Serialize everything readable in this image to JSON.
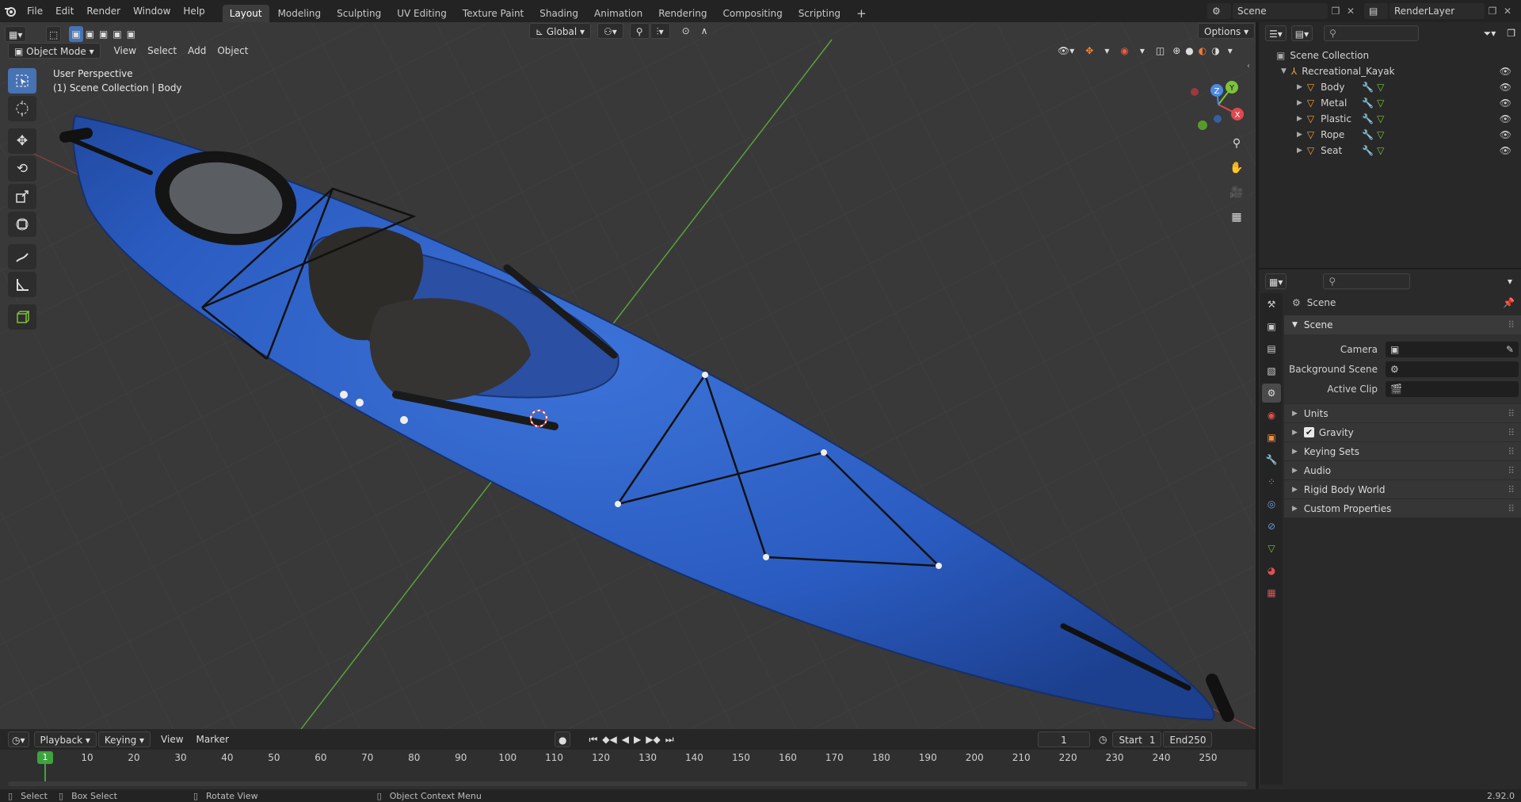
{
  "topbar": {
    "menus": [
      "File",
      "Edit",
      "Render",
      "Window",
      "Help"
    ],
    "workspaces": [
      "Layout",
      "Modeling",
      "Sculpting",
      "UV Editing",
      "Texture Paint",
      "Shading",
      "Animation",
      "Rendering",
      "Compositing",
      "Scripting"
    ],
    "active_workspace": "Layout",
    "scene_name": "Scene",
    "view_layer": "RenderLayer"
  },
  "viewport": {
    "mode": "Object Mode",
    "menus": [
      "View",
      "Select",
      "Add",
      "Object"
    ],
    "transform_orientation": "Global",
    "options_label": "Options",
    "overlay_title": "User Perspective",
    "overlay_subtitle": "(1) Scene Collection | Body",
    "gizmo_axes": [
      "X",
      "Y",
      "Z"
    ]
  },
  "toolbar_icons": [
    "select-box-icon",
    "cursor-icon",
    "move-icon",
    "rotate-icon",
    "scale-icon",
    "transform-icon",
    "annotate-icon",
    "measure-icon",
    "add-cube-icon"
  ],
  "outliner": {
    "root": "Scene Collection",
    "collection": "Recreational_Kayak",
    "objects": [
      "Body",
      "Metal",
      "Plastic",
      "Rope",
      "Seat"
    ]
  },
  "properties": {
    "context_title": "Scene",
    "section": "Scene",
    "fields": [
      {
        "label": "Camera",
        "value": ""
      },
      {
        "label": "Background Scene",
        "value": ""
      },
      {
        "label": "Active Clip",
        "value": ""
      }
    ],
    "subpanels": [
      "Units",
      "Gravity",
      "Keying Sets",
      "Audio",
      "Rigid Body World",
      "Custom Properties"
    ],
    "gravity_checked": true
  },
  "timeline": {
    "menus": [
      "Playback",
      "Keying",
      "View",
      "Marker"
    ],
    "current_frame": "1",
    "start_label": "Start",
    "start_value": "1",
    "end_label": "End",
    "end_value": "250",
    "ticks": [
      "10",
      "20",
      "30",
      "40",
      "50",
      "60",
      "70",
      "80",
      "90",
      "100",
      "110",
      "120",
      "130",
      "140",
      "150",
      "160",
      "170",
      "180",
      "190",
      "200",
      "210",
      "220",
      "230",
      "240",
      "250"
    ],
    "playhead_label": "1"
  },
  "statusbar": {
    "items": [
      "Select",
      "Box Select",
      "Rotate View",
      "Object Context Menu"
    ],
    "version": "2.92.0"
  },
  "colors": {
    "accent": "#4772b3",
    "kayak_blue": "#2d5fc4",
    "active_frame": "#3ea33e",
    "x_axis": "#e0484f",
    "y_axis": "#7ec23a",
    "z_axis": "#4b8ae3"
  }
}
